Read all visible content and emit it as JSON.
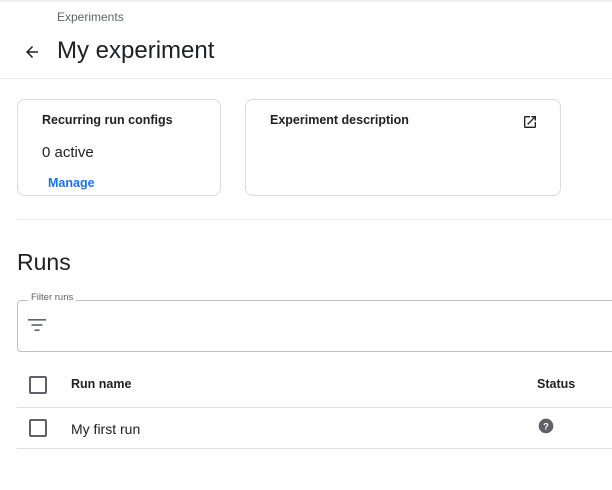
{
  "breadcrumb": "Experiments",
  "header": {
    "title": "My experiment",
    "back_icon": "arrow-back-icon"
  },
  "cards": {
    "recurring": {
      "title": "Recurring run configs",
      "value": "0 active",
      "link": "Manage"
    },
    "description": {
      "title": "Experiment description",
      "icon": "open-in-new-icon"
    }
  },
  "runs": {
    "title": "Runs",
    "filter": {
      "label": "Filter runs",
      "value": "",
      "icon": "filter-list-icon"
    },
    "columns": {
      "name": "Run name",
      "status": "Status"
    },
    "rows": [
      {
        "name": "My first run",
        "status": "unknown",
        "status_icon": "help-circle-icon"
      }
    ]
  },
  "colors": {
    "accent": "#1a73e8",
    "text": "#202124",
    "secondary": "#5f6368",
    "border": "#dadce0"
  }
}
